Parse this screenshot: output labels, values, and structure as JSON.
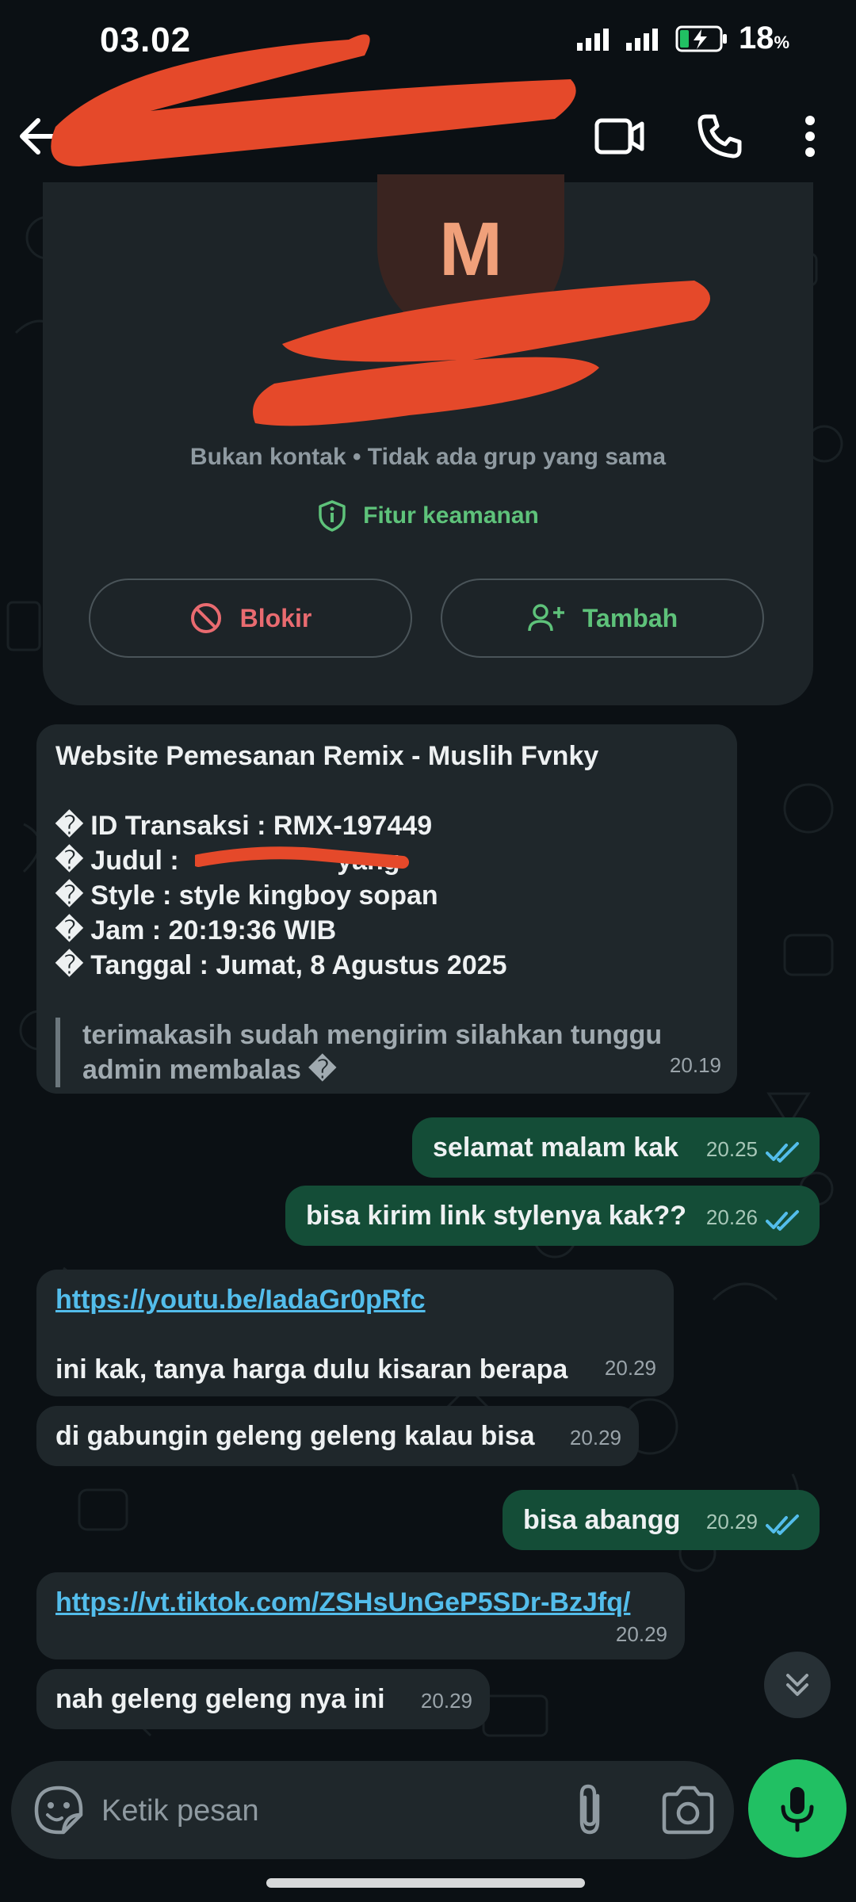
{
  "status_bar": {
    "time": "03.02",
    "battery_level": "18",
    "battery_unit": "%"
  },
  "header": {
    "icons": [
      "back-arrow-icon",
      "video-call-icon",
      "voice-call-icon",
      "more-vert-icon"
    ]
  },
  "profile": {
    "avatar_letter": "M",
    "subtitle": "Bukan kontak • Tidak ada grup yang sama",
    "security_label": "Fitur keamanan",
    "block_label": "Blokir",
    "add_label": "Tambah"
  },
  "messages": {
    "m1": {
      "title": "Website Pemesanan Remix - Muslih Fvnky",
      "line1": "� ID Transaksi : RMX-197449",
      "line2": "� Judul       : ",
      "line2_suffix": "yang",
      "line3": "� Style      : style kingboy sopan",
      "line4": "� Jam        : 20:19:36 WIB",
      "line5": "� Tanggal     : Jumat, 8 Agustus 2025",
      "quote1": "terimakasih sudah mengirim silahkan tunggu",
      "quote2": "admin membalas �",
      "time": "20.19"
    },
    "m2": {
      "text": "selamat malam kak",
      "time": "20.25"
    },
    "m3": {
      "text": "bisa kirim link stylenya kak??",
      "time": "20.26"
    },
    "m4": {
      "link": "https://youtu.be/IadaGr0pRfc",
      "text": "ini kak, tanya harga dulu kisaran berapa",
      "time": "20.29"
    },
    "m5": {
      "text": "di gabungin geleng geleng kalau bisa",
      "time": "20.29"
    },
    "m6": {
      "text": "bisa abangg",
      "time": "20.29"
    },
    "m7": {
      "link": "https://vt.tiktok.com/ZSHsUnGeP5SDr-BzJfq/",
      "time": "20.29"
    },
    "m8": {
      "text": "nah geleng geleng nya ini",
      "time": "20.29"
    }
  },
  "composer": {
    "placeholder": "Ketik pesan"
  },
  "colors": {
    "background": "#0b1014",
    "incoming_bubble": "#1f272b",
    "outgoing_bubble": "#144d37",
    "accent_green": "#21c063",
    "link_blue": "#53bdeb",
    "read_ticks": "#53bdeb",
    "redaction": "#e5492a"
  }
}
